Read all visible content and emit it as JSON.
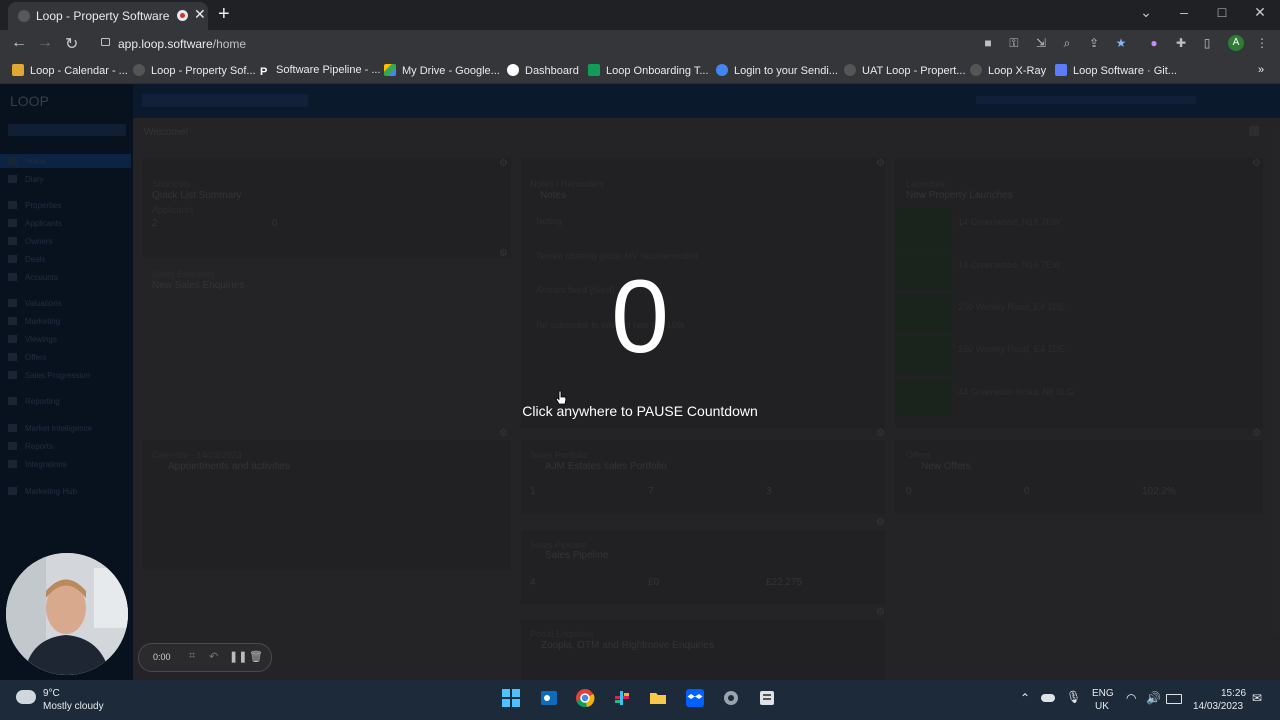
{
  "browser": {
    "tab_title": "Loop - Property Software",
    "new_tab": "+",
    "url_domain": "app.loop.software",
    "url_path": "/home",
    "window_controls": [
      "⌄",
      "–",
      "□",
      "✕"
    ],
    "profile_initial": "A",
    "bookmarks": [
      {
        "label": "Loop - Calendar - ...",
        "icon": "loop-icon",
        "color": "#e0a82e"
      },
      {
        "label": "Loop - Property Sof...",
        "icon": "loop-icon",
        "color": "#666666"
      },
      {
        "label": "Software Pipeline - ...",
        "icon": "p-icon",
        "color": "#ffffff"
      },
      {
        "label": "My Drive - Google...",
        "icon": "drive-icon",
        "color": "#34a853"
      },
      {
        "label": "Dashboard",
        "icon": "google-icon",
        "color": "#ffffff"
      },
      {
        "label": "Loop Onboarding T...",
        "icon": "plus-icon",
        "color": "#0f9d58"
      },
      {
        "label": "Login to your Sendi...",
        "icon": "globe-icon",
        "color": "#4285f4"
      },
      {
        "label": "UAT Loop - Propert...",
        "icon": "loop-icon",
        "color": "#666666"
      },
      {
        "label": "Loop X-Ray",
        "icon": "loop-icon",
        "color": "#666666"
      },
      {
        "label": "Loop Software · Git...",
        "icon": "stack-icon",
        "color": "#5c7cfa"
      }
    ]
  },
  "app": {
    "logo": "LOOP",
    "welcome": "Welcome!",
    "sidebar_items": [
      "Home",
      "Diary",
      "Properties",
      "Applicants",
      "Owners",
      "Deals",
      "Accounts",
      "Valuations",
      "Marketing",
      "Viewings",
      "Offers",
      "Sales Progression",
      "Reporting",
      "Market Intelligence",
      "Reports",
      "Integrations",
      "Marketing Hub"
    ],
    "widgets": {
      "quick_list": {
        "section": "Shortcuts",
        "title": "Quick List Summary",
        "sub": "Applicants",
        "value": "2",
        "value2": "0"
      },
      "sales_enquiries": {
        "section": "Sales Enquiries",
        "title": "New Sales Enquiries"
      },
      "notes": {
        "section": "Notes / Reminders",
        "title": "Notes",
        "items": [
          "Noting",
          "Tenant chasing group MV recommended",
          "Tenant chasing group MV recommended",
          "Arrears fixed (fixed)",
          "Re-subscribe to interest rate the 10%"
        ]
      },
      "launches": {
        "section": "Launches",
        "title": "New Property Launches",
        "items": [
          "14 Greenwood, N16 7EW",
          "14 Greenwood, N16 7EW",
          "230 Wesley Road, E4 1DE",
          "230 Wesley Road, E4 1DE",
          "44 Greenwich Road, N8 0LG"
        ]
      },
      "appointments": {
        "section": "Calendar - 14/03/2023",
        "title": "Appointments and activities"
      },
      "portfolio": {
        "section": "Sales Portfolio",
        "title": "AJM Estates sales Portfolio",
        "values": [
          "1",
          "7",
          "3"
        ]
      },
      "offers": {
        "section": "Offers",
        "title": "New Offers",
        "values": [
          "0",
          "0",
          "102.2%"
        ]
      },
      "pipeline": {
        "section": "Sales Pipeline",
        "title": "Sales Pipeline",
        "values": [
          "4",
          "£0",
          "£22,275"
        ]
      },
      "zoopla": {
        "section": "Portal Enquiries",
        "title": "Zoopla, OTM and Rightmove Enquiries"
      }
    }
  },
  "overlay": {
    "countdown": "0",
    "pause_text": "Click anywhere to PAUSE Countdown"
  },
  "recorder": {
    "time": "0:00"
  },
  "taskbar": {
    "weather_temp": "9°C",
    "weather_desc": "Mostly cloudy",
    "lang": "ENG",
    "region": "UK",
    "time": "15:26",
    "date": "14/03/2023"
  }
}
